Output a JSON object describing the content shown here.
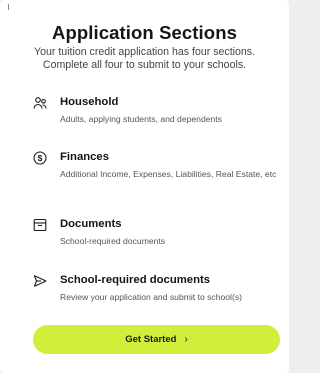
{
  "header": {
    "title": "Application Sections",
    "subtitle": "Your tuition credit application has four sections. Complete all four to submit to your schools."
  },
  "sections": [
    {
      "icon": "people-icon",
      "title": "Household",
      "description": "Adults, applying students, and dependents"
    },
    {
      "icon": "dollar-circle-icon",
      "title": "Finances",
      "description": "Additional Income, Expenses, Liabilities, Real Estate, etc"
    },
    {
      "icon": "archive-box-icon",
      "title": "Documents",
      "description": "School-required documents"
    },
    {
      "icon": "send-icon",
      "title": "School-required documents",
      "description": "Review your application and submit to school(s)"
    }
  ],
  "cta": {
    "label": "Get Started",
    "icon": "chevron-right-icon",
    "color": "#d2ed3a"
  }
}
